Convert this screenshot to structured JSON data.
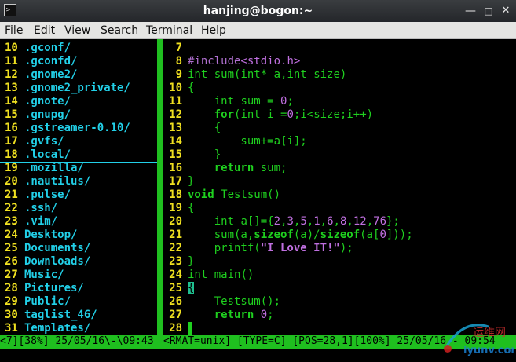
{
  "window": {
    "title": "hanjing@bogon:~",
    "icon": "terminal-icon",
    "controls": [
      "minimize-icon",
      "maximize-icon",
      "close-icon"
    ]
  },
  "menu": [
    "File",
    "Edit",
    "View",
    "Search",
    "Terminal",
    "Help"
  ],
  "explorer": {
    "rows": [
      {
        "n": "10",
        "name": ".gconf/"
      },
      {
        "n": "11",
        "name": ".gconfd/"
      },
      {
        "n": "12",
        "name": ".gnome2/"
      },
      {
        "n": "13",
        "name": ".gnome2_private/"
      },
      {
        "n": "14",
        "name": ".gnote/"
      },
      {
        "n": "15",
        "name": ".gnupg/"
      },
      {
        "n": "16",
        "name": ".gstreamer-0.10/"
      },
      {
        "n": "17",
        "name": ".gvfs/"
      },
      {
        "n": "18",
        "name": ".local/"
      },
      {
        "n": "19",
        "name": ".mozilla/"
      },
      {
        "n": "20",
        "name": ".nautilus/"
      },
      {
        "n": "21",
        "name": ".pulse/"
      },
      {
        "n": "22",
        "name": ".ssh/"
      },
      {
        "n": "23",
        "name": ".vim/"
      },
      {
        "n": "24",
        "name": "Desktop/"
      },
      {
        "n": "25",
        "name": "Documents/"
      },
      {
        "n": "26",
        "name": "Downloads/"
      },
      {
        "n": "27",
        "name": "Music/"
      },
      {
        "n": "28",
        "name": "Pictures/"
      },
      {
        "n": "29",
        "name": "Public/"
      },
      {
        "n": "30",
        "name": "taglist_46/"
      },
      {
        "n": "31",
        "name": "Templates/"
      }
    ]
  },
  "editor": {
    "lines": [
      {
        "n": "7",
        "tokens": []
      },
      {
        "n": "8",
        "tokens": [
          {
            "t": "#include",
            "c": "pre"
          },
          {
            "t": "<stdio.h>",
            "c": "num"
          }
        ]
      },
      {
        "n": "9",
        "tokens": [
          {
            "t": "int",
            "c": "type"
          },
          {
            "t": " sum(",
            "c": "norm"
          },
          {
            "t": "int",
            "c": "type"
          },
          {
            "t": "* a,",
            "c": "norm"
          },
          {
            "t": "int",
            "c": "type"
          },
          {
            "t": " size)",
            "c": "norm"
          }
        ]
      },
      {
        "n": "10",
        "tokens": [
          {
            "t": "{",
            "c": "brace"
          }
        ]
      },
      {
        "n": "11",
        "tokens": [
          {
            "t": "    ",
            "c": "norm"
          },
          {
            "t": "int",
            "c": "type"
          },
          {
            "t": " sum = ",
            "c": "norm"
          },
          {
            "t": "0",
            "c": "num"
          },
          {
            "t": ";",
            "c": "norm"
          }
        ]
      },
      {
        "n": "12",
        "tokens": [
          {
            "t": "    ",
            "c": "norm"
          },
          {
            "t": "for",
            "c": "kw"
          },
          {
            "t": "(",
            "c": "norm"
          },
          {
            "t": "int",
            "c": "type"
          },
          {
            "t": " i =",
            "c": "norm"
          },
          {
            "t": "0",
            "c": "num"
          },
          {
            "t": ";i<size;i++)",
            "c": "norm"
          }
        ]
      },
      {
        "n": "13",
        "tokens": [
          {
            "t": "    {",
            "c": "brace"
          }
        ]
      },
      {
        "n": "14",
        "tokens": [
          {
            "t": "        sum+=a[i];",
            "c": "norm"
          }
        ]
      },
      {
        "n": "15",
        "tokens": [
          {
            "t": "    }",
            "c": "brace"
          }
        ]
      },
      {
        "n": "16",
        "tokens": [
          {
            "t": "    ",
            "c": "norm"
          },
          {
            "t": "return",
            "c": "kw"
          },
          {
            "t": " sum;",
            "c": "norm"
          }
        ]
      },
      {
        "n": "17",
        "tokens": [
          {
            "t": "}",
            "c": "brace"
          }
        ]
      },
      {
        "n": "18",
        "tokens": [
          {
            "t": "void",
            "c": "kw"
          },
          {
            "t": " Testsum()",
            "c": "norm"
          }
        ]
      },
      {
        "n": "19",
        "tokens": [
          {
            "t": "{",
            "c": "brace"
          }
        ]
      },
      {
        "n": "20",
        "tokens": [
          {
            "t": "    ",
            "c": "norm"
          },
          {
            "t": "int",
            "c": "type"
          },
          {
            "t": " a[]={",
            "c": "norm"
          },
          {
            "t": "2",
            "c": "num"
          },
          {
            "t": ",",
            "c": "norm"
          },
          {
            "t": "3",
            "c": "num"
          },
          {
            "t": ",",
            "c": "norm"
          },
          {
            "t": "5",
            "c": "num"
          },
          {
            "t": ",",
            "c": "norm"
          },
          {
            "t": "1",
            "c": "num"
          },
          {
            "t": ",",
            "c": "norm"
          },
          {
            "t": "6",
            "c": "num"
          },
          {
            "t": ",",
            "c": "norm"
          },
          {
            "t": "8",
            "c": "num"
          },
          {
            "t": ",",
            "c": "norm"
          },
          {
            "t": "12",
            "c": "num"
          },
          {
            "t": ",",
            "c": "norm"
          },
          {
            "t": "76",
            "c": "num"
          },
          {
            "t": "};",
            "c": "norm"
          }
        ]
      },
      {
        "n": "21",
        "tokens": [
          {
            "t": "    sum(a,",
            "c": "norm"
          },
          {
            "t": "sizeof",
            "c": "kw"
          },
          {
            "t": "(a)/",
            "c": "norm"
          },
          {
            "t": "sizeof",
            "c": "kw"
          },
          {
            "t": "(a[",
            "c": "norm"
          },
          {
            "t": "0",
            "c": "num"
          },
          {
            "t": "]));",
            "c": "norm"
          }
        ]
      },
      {
        "n": "22",
        "tokens": [
          {
            "t": "    printf(",
            "c": "norm"
          },
          {
            "t": "\"I Love IT!\"",
            "c": "str"
          },
          {
            "t": ");",
            "c": "norm"
          }
        ]
      },
      {
        "n": "23",
        "tokens": [
          {
            "t": "}",
            "c": "brace"
          }
        ]
      },
      {
        "n": "24",
        "tokens": [
          {
            "t": "int",
            "c": "type"
          },
          {
            "t": " main()",
            "c": "norm"
          }
        ]
      },
      {
        "n": "25",
        "tokens": [
          {
            "t": "{",
            "c": "cursorbrace"
          }
        ]
      },
      {
        "n": "26",
        "tokens": [
          {
            "t": "    Testsum();",
            "c": "norm"
          }
        ]
      },
      {
        "n": "27",
        "tokens": [
          {
            "t": "    ",
            "c": "norm"
          },
          {
            "t": "return",
            "c": "kw"
          },
          {
            "t": " ",
            "c": "norm"
          },
          {
            "t": "0",
            "c": "num"
          },
          {
            "t": ";",
            "c": "norm"
          }
        ]
      },
      {
        "n": "28",
        "tokens": [
          {
            "t": "",
            "c": "cursor"
          }
        ]
      }
    ]
  },
  "status": {
    "left": "<7][38%] 25/05/16\\-\\09:43",
    "right": "<RMAT=unix] [TYPE=C] [POS=28,1][100%] 25/05/16 - 09:54"
  },
  "watermark": {
    "text_cn": "运维网",
    "text_en": "iyunv.com"
  },
  "colors": {
    "separator": "#1fbf1f",
    "line_number": "#f0e020",
    "directory": "#22d0e8",
    "keyword": "#1fd01f",
    "constant": "#c070e0"
  }
}
